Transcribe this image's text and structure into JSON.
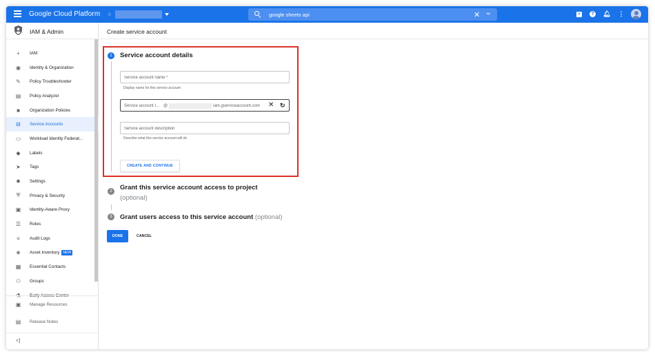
{
  "topbar": {
    "brand": "Google Cloud Platform",
    "search_value": "google sheets api",
    "clear_icon": "close-icon",
    "expand_icon": "chevron-down-icon"
  },
  "sidebar": {
    "title": "IAM & Admin",
    "items": [
      {
        "label": "IAM",
        "icon": "person-add-icon"
      },
      {
        "label": "Identity & Organization",
        "icon": "account-circle-icon"
      },
      {
        "label": "Policy Troubleshooter",
        "icon": "wrench-icon"
      },
      {
        "label": "Policy Analyzer",
        "icon": "search-doc-icon"
      },
      {
        "label": "Organization Policies",
        "icon": "document-icon"
      },
      {
        "label": "Service Accounts",
        "icon": "service-account-icon",
        "active": true
      },
      {
        "label": "Workload Identity Federat...",
        "icon": "id-card-icon"
      },
      {
        "label": "Labels",
        "icon": "tag-icon"
      },
      {
        "label": "Tags",
        "icon": "arrow-tag-icon"
      },
      {
        "label": "Settings",
        "icon": "gear-icon"
      },
      {
        "label": "Privacy & Security",
        "icon": "shield-icon"
      },
      {
        "label": "Identity-Aware Proxy",
        "icon": "proxy-icon"
      },
      {
        "label": "Roles",
        "icon": "roles-icon"
      },
      {
        "label": "Audit Logs",
        "icon": "list-icon"
      },
      {
        "label": "Asset Inventory",
        "icon": "diamond-icon",
        "badge": "NEW"
      },
      {
        "label": "Essential Contacts",
        "icon": "contact-icon"
      },
      {
        "label": "Groups",
        "icon": "group-icon"
      },
      {
        "label": "Early Access Center",
        "icon": "early-access-icon"
      }
    ],
    "footer": [
      {
        "label": "Manage Resources",
        "icon": "folder-gear-icon"
      },
      {
        "label": "Release Notes",
        "icon": "notes-icon"
      }
    ],
    "collapse_label": "<|"
  },
  "main": {
    "page_title": "Create service account",
    "step1": {
      "number": "1",
      "title": "Service account details",
      "name_placeholder": "Service account name *",
      "name_hint": "Display name for this service account",
      "id_label": "Service account I...",
      "id_at": "@",
      "id_domain": "iam.gserviceaccount.com",
      "description_placeholder": "Service account description",
      "description_hint": "Describe what this service account will do",
      "create_button": "CREATE AND CONTINUE"
    },
    "step2": {
      "number": "2",
      "title": "Grant this service account access to project",
      "optional": "(optional)"
    },
    "step3": {
      "number": "3",
      "title": "Grant users access to this service account",
      "optional": "(optional)"
    },
    "done_button": "DONE",
    "cancel_button": "CANCEL"
  },
  "colors": {
    "brand_blue": "#1a73e8",
    "highlight_red": "#d93025",
    "active_bg": "#e8f0fe"
  }
}
